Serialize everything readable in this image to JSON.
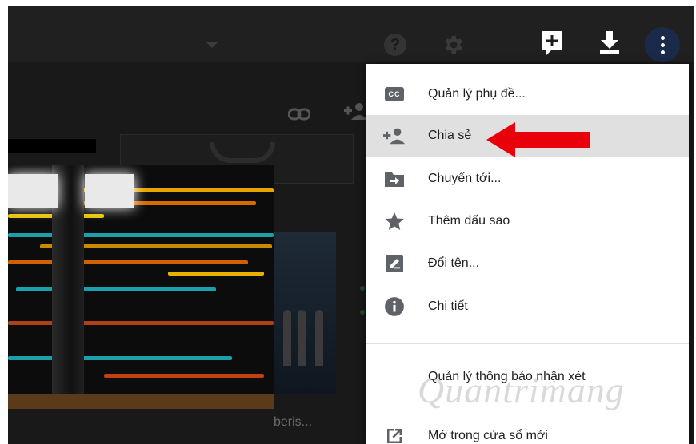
{
  "colors": {
    "accent_arrow": "#e8000b",
    "menu_background": "#ffffff",
    "menu_active": "#e0e0e0",
    "icon_gray": "#5f6368"
  },
  "toolbar": {
    "icons": [
      "help-icon",
      "settings-gear-icon",
      "add-to-drive-icon",
      "download-icon",
      "more-vert-icon"
    ]
  },
  "background": {
    "caption": "beris..."
  },
  "menu": {
    "items": [
      {
        "label": "Quản lý phụ đề...",
        "icon": "closed-captions-icon",
        "icon_text": "CC"
      },
      {
        "label": "Chia sẻ",
        "icon": "share-person-add-icon"
      },
      {
        "label": "Chuyển tới...",
        "icon": "move-to-folder-icon"
      },
      {
        "label": "Thêm dấu sao",
        "icon": "star-icon"
      },
      {
        "label": "Đổi tên...",
        "icon": "rename-pencil-icon"
      },
      {
        "label": "Chi tiết",
        "icon": "info-icon"
      },
      {
        "label": "Quản lý thông báo nhận xét",
        "icon": ""
      },
      {
        "label": "Mở trong cửa sổ mới",
        "icon": "open-in-new-icon"
      }
    ],
    "active_index": 1
  },
  "watermark": {
    "text": "Quantrimang"
  }
}
